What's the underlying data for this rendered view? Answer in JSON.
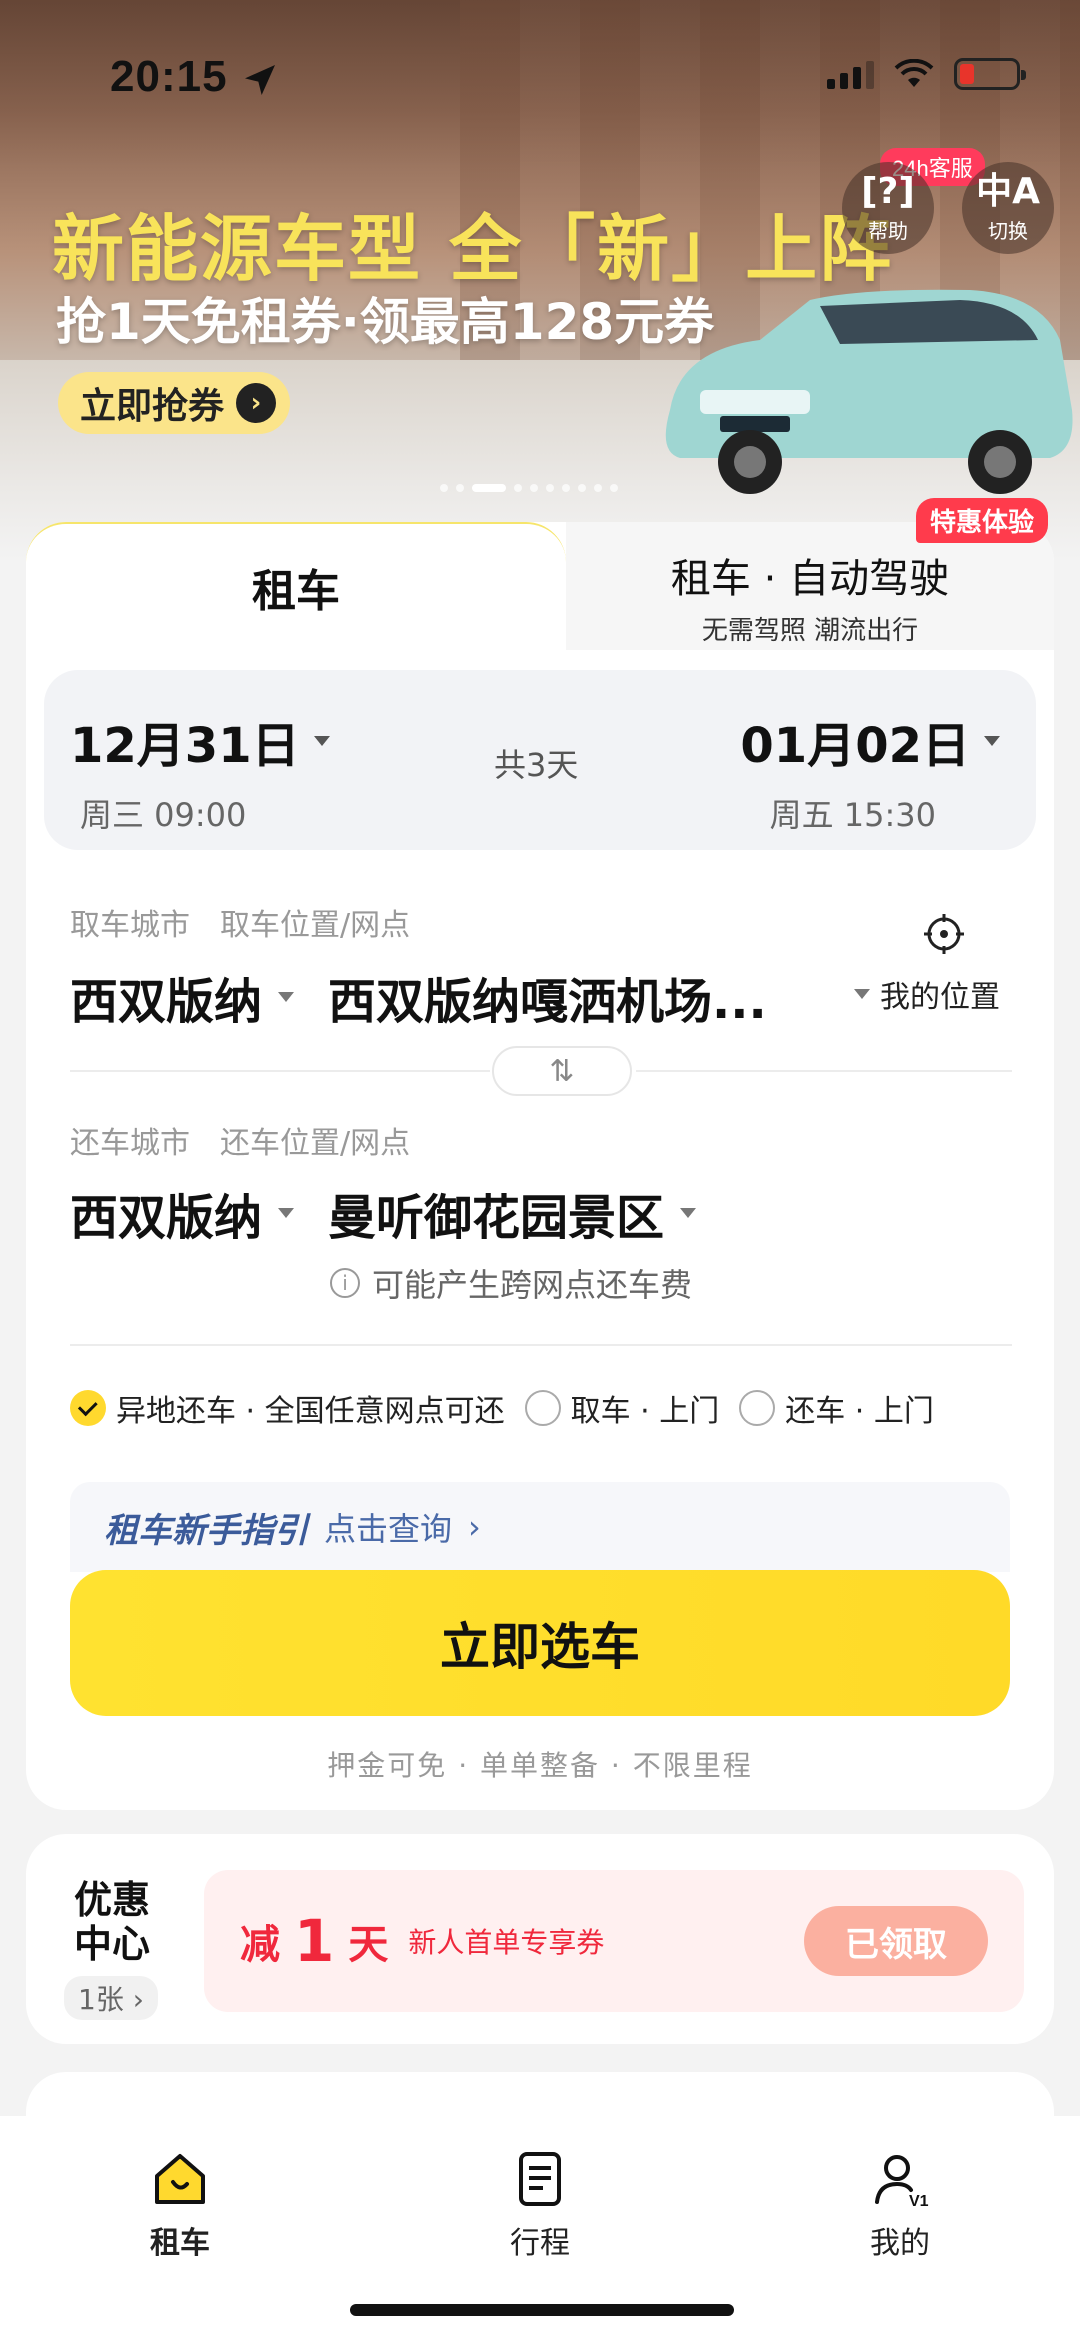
{
  "status_bar": {
    "time": "20:15"
  },
  "banner": {
    "title": "新能源车型 全「新」上阵",
    "subtitle": "抢1天免租券·领最高128元券",
    "button": "立即抢券",
    "help_badge": "24h客服",
    "help_label": "帮助",
    "switch_label": "切换"
  },
  "tabs": {
    "rent": "租车",
    "auto_drive": "租车 · 自动驾驶",
    "auto_drive_sub": "无需驾照 潮流出行",
    "promo_tag": "特惠体验"
  },
  "dates": {
    "start_date": "12月31日",
    "start_sub": "周三 09:00",
    "days": "共3天",
    "end_date": "01月02日",
    "end_sub": "周五 15:30"
  },
  "pickup": {
    "city_label": "取车城市",
    "city": "西双版纳",
    "location_label": "取车位置/网点",
    "location": "西双版纳嘎洒机场...",
    "my_location": "我的位置"
  },
  "return": {
    "city_label": "还车城市",
    "city": "西双版纳",
    "location_label": "还车位置/网点",
    "location": "曼听御花园景区",
    "fee_note": "可能产生跨网点还车费"
  },
  "options": [
    {
      "label": "异地还车 · 全国任意网点可还",
      "checked": true
    },
    {
      "label": "取车 · 上门",
      "checked": false
    },
    {
      "label": "还车 · 上门",
      "checked": false
    }
  ],
  "guide": {
    "title": "租车新手指引",
    "link": "点击查询"
  },
  "cta": "立即选车",
  "features": "押金可免 · 单单整备 · 不限里程",
  "coupon": {
    "title": "优惠中心",
    "count": "1张",
    "prefix": "减",
    "amount": "1",
    "unit": "天",
    "desc": "新人首单专享券",
    "claimed": "已领取"
  },
  "tabbar": [
    {
      "label": "租车",
      "icon": "home-icon",
      "active": true
    },
    {
      "label": "行程",
      "icon": "itinerary-icon",
      "active": false
    },
    {
      "label": "我的",
      "icon": "profile-icon",
      "active": false
    }
  ],
  "colors": {
    "accent": "#ffe02f",
    "promo": "#ff3b4c",
    "coupon_text": "#f0283c"
  }
}
